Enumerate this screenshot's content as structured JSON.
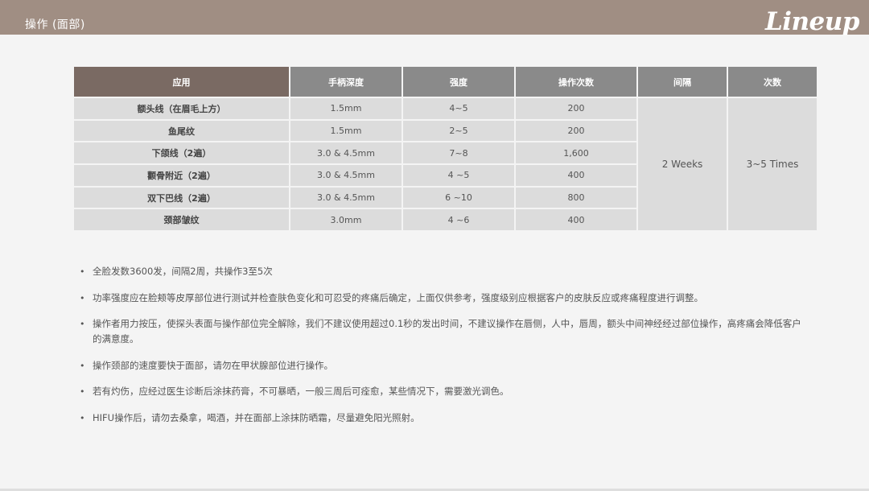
{
  "header": {
    "title": "操作 (面部)",
    "logo": "Lineup"
  },
  "table": {
    "columns": [
      "应用",
      "手柄深度",
      "强度",
      "操作次数",
      "间隔",
      "次数"
    ],
    "rows": [
      {
        "application": "额头线（在眉毛上方）",
        "depth": "1.5mm",
        "intensity": "4~5",
        "shots": "200"
      },
      {
        "application": "鱼尾纹",
        "depth": "1.5mm",
        "intensity": "2~5",
        "shots": "200"
      },
      {
        "application": "下颌线（2遍）",
        "depth": "3.0 & 4.5mm",
        "intensity": "7~8",
        "shots": "1,600"
      },
      {
        "application": "颧骨附近（2遍）",
        "depth": "3.0 & 4.5mm",
        "intensity": "4 ~5",
        "shots": "400"
      },
      {
        "application": "双下巴线（2遍）",
        "depth": "3.0 & 4.5mm",
        "intensity": "6 ~10",
        "shots": "800"
      },
      {
        "application": "颈部皱纹",
        "depth": "3.0mm",
        "intensity": "4 ~6",
        "shots": "400"
      }
    ],
    "interval": "2 Weeks",
    "times": "3~5 Times"
  },
  "notes": [
    "全脸发数3600发，间隔2周，共操作3至5次",
    "功率强度应在脸颊等皮厚部位进行测试并检查肤色变化和可忍受的疼痛后确定，上面仅供参考，强度级别应根据客户的皮肤反应或疼痛程度进行调整。",
    "操作者用力按压，使探头表面与操作部位完全解除，我们不建议使用超过0.1秒的发出时间，不建议操作在唇侧，人中，唇周，额头中间神经经过部位操作，高疼痛会降低客户的满意度。",
    "操作颈部的速度要快于面部，请勿在甲状腺部位进行操作。",
    "若有灼伤，应经过医生诊断后涂抹药膏，不可暴晒，一般三周后可痊愈，某些情况下，需要激光调色。",
    "HIFU操作后，请勿去桑拿，喝酒，并在面部上涂抹防晒霜，尽量避免阳光照射。"
  ],
  "colors": {
    "header_bg": "#a08e83",
    "table_header": "#8a8a8a",
    "table_header_first": "#7a6a63",
    "table_cell": "#dcdcdc",
    "page_bg": "#f4f4f4"
  }
}
